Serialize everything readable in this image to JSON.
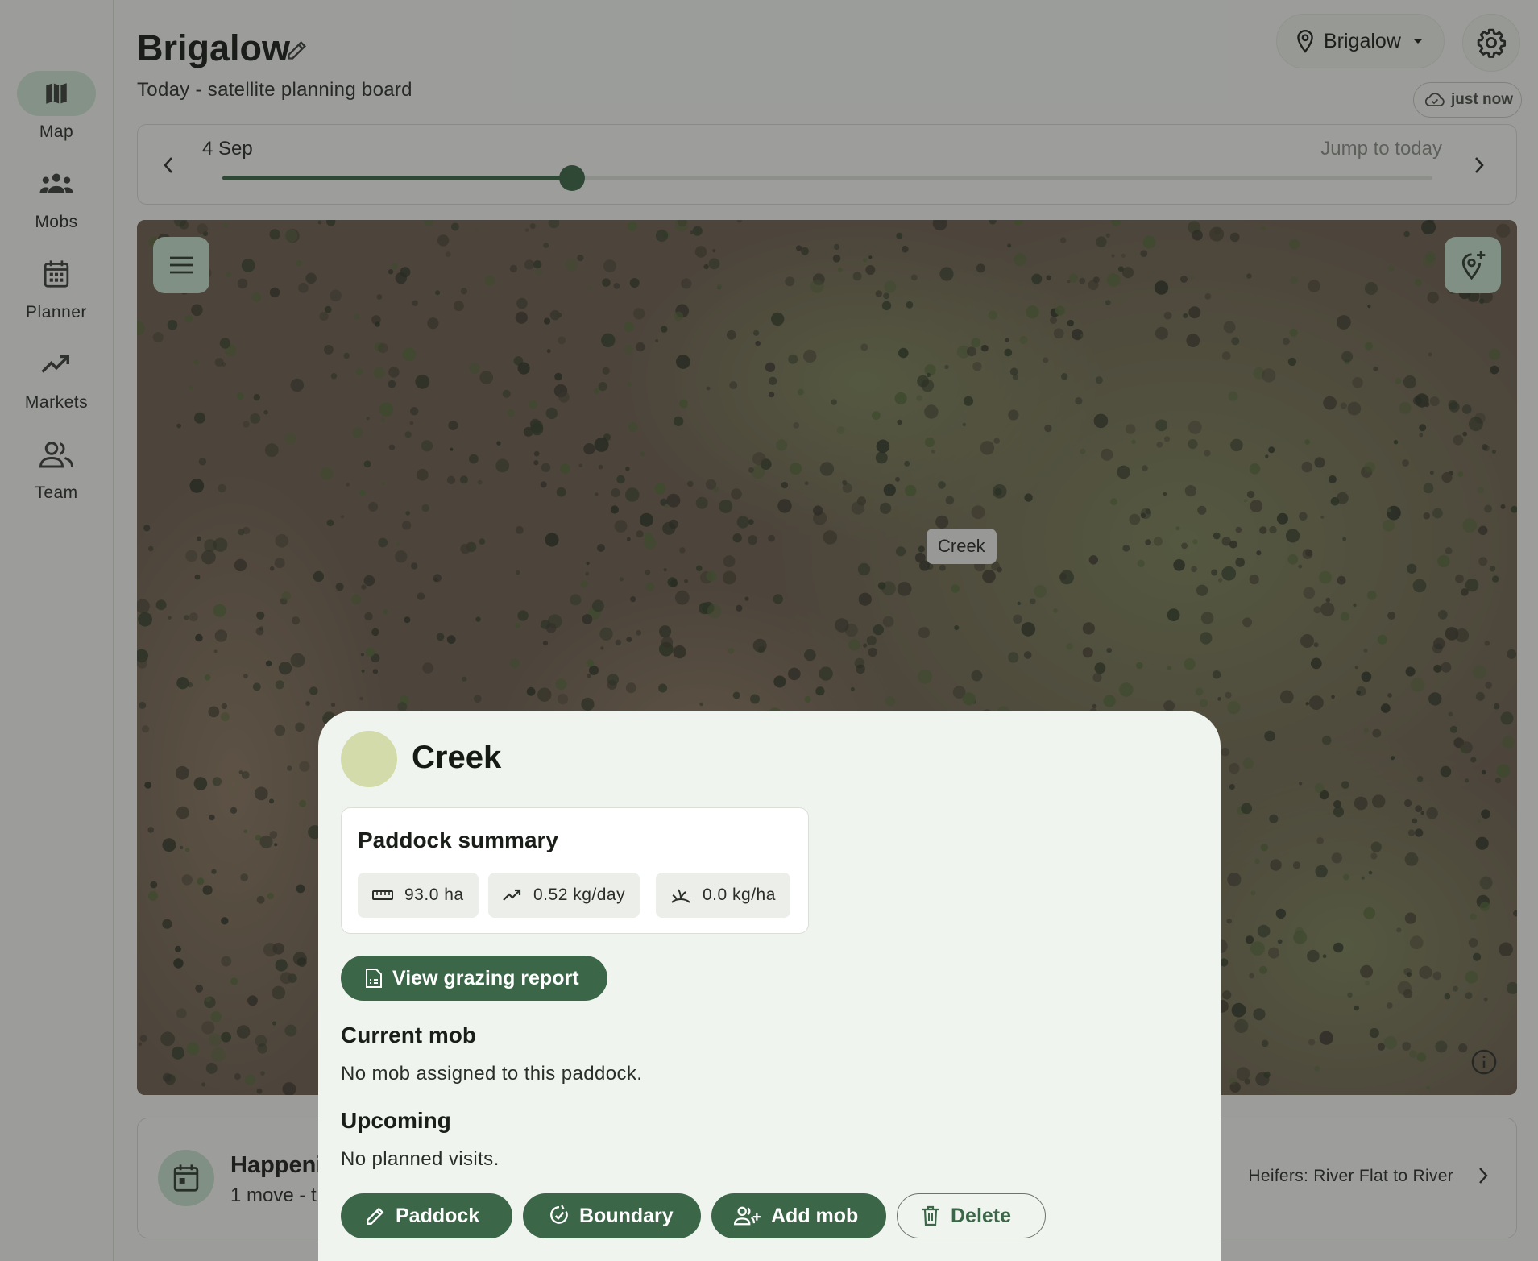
{
  "nav": {
    "items": [
      {
        "label": "Map",
        "icon": "map-icon",
        "active": true
      },
      {
        "label": "Mobs",
        "icon": "groups-icon"
      },
      {
        "label": "Planner",
        "icon": "calendar-icon"
      },
      {
        "label": "Markets",
        "icon": "trending-up-icon"
      },
      {
        "label": "Team",
        "icon": "people-icon"
      }
    ]
  },
  "header": {
    "title": "Brigalow",
    "subtitle": "Today - satellite planning board",
    "location": "Brigalow",
    "sync_status": "just now"
  },
  "timeline": {
    "date": "4 Sep",
    "jump_label": "Jump to today",
    "position_fraction": 0.289
  },
  "map": {
    "paddock_label": "Creek"
  },
  "happening": {
    "title": "Happenin",
    "subtitle": "1 move - t",
    "right_text": "Heifers: River Flat to River"
  },
  "sheet": {
    "title": "Creek",
    "swatch_color": "#d2dba9",
    "summary": {
      "title": "Paddock summary",
      "area": "93.0 ha",
      "growth": "0.52 kg/day",
      "feed": "0.0 kg/ha"
    },
    "report_button": "View grazing report",
    "current_mob_heading": "Current mob",
    "current_mob_text": "No mob assigned to this paddock.",
    "upcoming_heading": "Upcoming",
    "upcoming_text": "No planned visits.",
    "actions": {
      "paddock": "Paddock",
      "boundary": "Boundary",
      "add_mob": "Add mob",
      "delete": "Delete"
    }
  },
  "colors": {
    "primary": "#3c6648",
    "primary_container": "#c8e2cd",
    "nav_active": "#cfe6d2"
  }
}
